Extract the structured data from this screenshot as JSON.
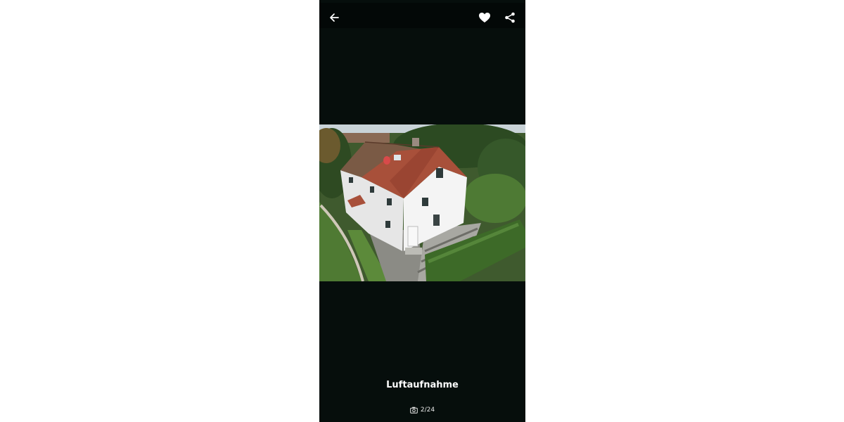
{
  "header": {
    "back_icon": "arrow-left-icon",
    "favorite_icon": "heart-icon",
    "share_icon": "share-icon"
  },
  "gallery": {
    "caption": "Luftaufnahme",
    "counter": "2/24",
    "counter_icon": "camera-icon"
  },
  "colors": {
    "background": "#060e0c",
    "text": "#ffffff"
  }
}
